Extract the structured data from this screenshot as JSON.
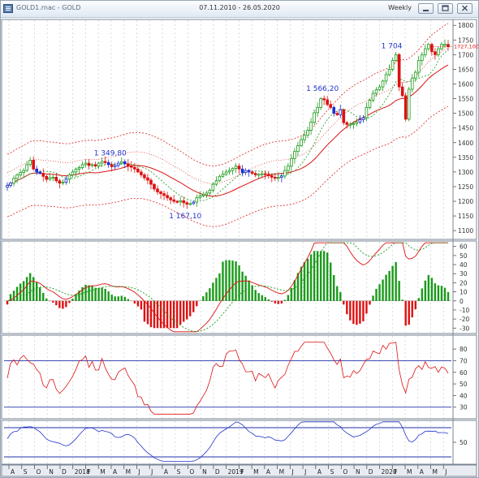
{
  "window": {
    "title": "GOLD1.rnac - GOLD",
    "period": "07.11.2010 - 26.05.2020",
    "timeframe": "Weekly",
    "buttons": [
      "minimize-icon",
      "restore-icon",
      "close-icon"
    ]
  },
  "colors": {
    "bull": "#1a9a1a",
    "bear": "#dd1111",
    "neutral": "#1a2fd0",
    "ma": "#dd1111",
    "envelope": "#dd2222",
    "signal": "#1a9a1a",
    "rsi": "#dd1111",
    "stoch": "#2233cc",
    "level": "#2233aa",
    "last_price": "#dd1111"
  },
  "price_panel": {
    "y_ticks": [
      "1800",
      "1750",
      "1700",
      "1650",
      "1600",
      "1550",
      "1500",
      "1450",
      "1400",
      "1350",
      "1300",
      "1250",
      "1200",
      "1150",
      "1100"
    ],
    "last_price": "1727,100",
    "annotations": [
      "1 349,80",
      "1 167,10",
      "1 566,20",
      "1 704"
    ]
  },
  "macd_panel": {
    "y_ticks": [
      "60",
      "50",
      "40",
      "30",
      "20",
      "10",
      "0",
      "-10",
      "-20",
      "-30"
    ]
  },
  "rsi_panel": {
    "y_ticks": [
      "80",
      "70",
      "60",
      "50",
      "40",
      "30"
    ],
    "levels": [
      70,
      30
    ]
  },
  "stoch_panel": {
    "y_ticks": [
      "50"
    ]
  },
  "time_axis": [
    "A",
    "S",
    "O",
    "N",
    "D",
    "2018",
    "F",
    "M",
    "A",
    "M",
    "J",
    "J",
    "A",
    "S",
    "O",
    "N",
    "D",
    "2019",
    "F",
    "M",
    "A",
    "M",
    "J",
    "J",
    "A",
    "S",
    "O",
    "N",
    "D",
    "2020",
    "F",
    "M",
    "A",
    "M",
    "J"
  ],
  "chart_data": {
    "type": "candlestick",
    "price_axis": {
      "ylim": [
        1070,
        1820
      ]
    },
    "macd_axis": {
      "ylim": [
        -36,
        66
      ]
    },
    "rsi_axis": {
      "ylim": [
        20,
        92
      ]
    },
    "closes": [
      1254,
      1262,
      1278,
      1290,
      1298,
      1305,
      1325,
      1340,
      1310,
      1300,
      1295,
      1285,
      1275,
      1280,
      1282,
      1270,
      1262,
      1265,
      1275,
      1290,
      1300,
      1310,
      1315,
      1325,
      1330,
      1322,
      1325,
      1320,
      1330,
      1336,
      1332,
      1325,
      1318,
      1322,
      1330,
      1335,
      1328,
      1320,
      1316,
      1310,
      1300,
      1290,
      1280,
      1272,
      1258,
      1242,
      1232,
      1226,
      1220,
      1212,
      1205,
      1200,
      1198,
      1202,
      1195,
      1190,
      1192,
      1197,
      1212,
      1218,
      1222,
      1228,
      1238,
      1258,
      1270,
      1285,
      1292,
      1300,
      1305,
      1312,
      1320,
      1310,
      1298,
      1305,
      1300,
      1295,
      1290,
      1292,
      1294,
      1292,
      1287,
      1282,
      1280,
      1282,
      1286,
      1305,
      1320,
      1346,
      1370,
      1390,
      1410,
      1425,
      1442,
      1470,
      1502,
      1520,
      1550,
      1546,
      1530,
      1520,
      1500,
      1495,
      1512,
      1468,
      1462,
      1463,
      1465,
      1470,
      1478,
      1485,
      1520,
      1545,
      1568,
      1580,
      1590,
      1610,
      1632,
      1650,
      1680,
      1700,
      1590,
      1560,
      1480,
      1582,
      1620,
      1640,
      1680,
      1700,
      1720,
      1735,
      1710,
      1700,
      1720,
      1735,
      1735,
      1727
    ]
  }
}
